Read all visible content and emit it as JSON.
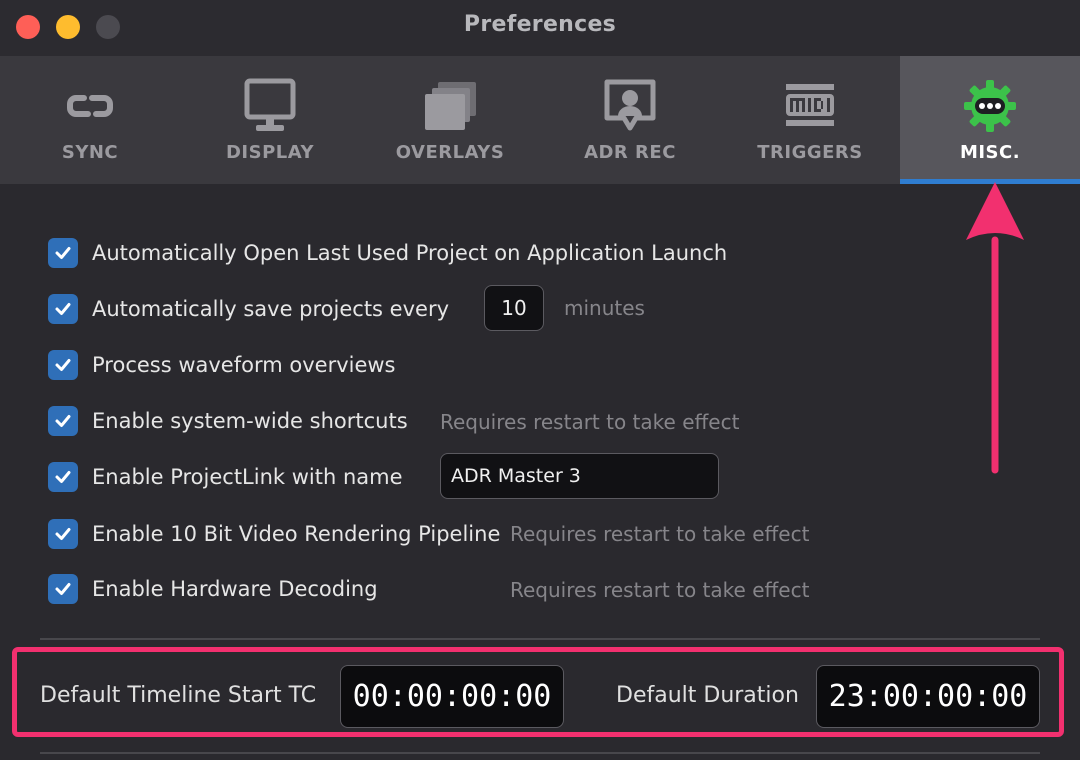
{
  "window": {
    "title": "Preferences"
  },
  "tabs": [
    {
      "label": "SYNC",
      "icon": "sync-icon"
    },
    {
      "label": "DISPLAY",
      "icon": "display-icon"
    },
    {
      "label": "OVERLAYS",
      "icon": "overlays-icon"
    },
    {
      "label": "ADR REC",
      "icon": "adr-rec-icon"
    },
    {
      "label": "TRIGGERS",
      "icon": "midi-icon"
    },
    {
      "label": "MISC.",
      "icon": "gear-dots-icon",
      "active": true
    }
  ],
  "options": {
    "auto_open": {
      "label": "Automatically Open Last Used Project on Application Launch",
      "checked": true
    },
    "auto_save": {
      "label": "Automatically save projects every",
      "checked": true,
      "value": "10",
      "unit": "minutes"
    },
    "waveform": {
      "label": "Process waveform overviews",
      "checked": true
    },
    "shortcuts": {
      "label": "Enable system-wide shortcuts",
      "checked": true,
      "hint": "Requires restart to take effect"
    },
    "projectlink": {
      "label": "Enable ProjectLink with name",
      "checked": true,
      "value": "ADR Master 3"
    },
    "tenbit": {
      "label": "Enable 10 Bit Video Rendering Pipeline",
      "checked": true,
      "hint": "Requires restart to take effect"
    },
    "hwdecode": {
      "label": "Enable Hardware Decoding",
      "checked": true,
      "hint": "Requires restart to take effect"
    }
  },
  "timeline": {
    "start_label": "Default Timeline Start TC",
    "start_value": "00:00:00:00",
    "duration_label": "Default Duration",
    "duration_value": "23:00:00:00"
  },
  "colors": {
    "accent": "#2f7dd0",
    "checkbox": "#2f6fb8",
    "annotation": "#f2306f",
    "misc_icon": "#3cc24a"
  }
}
